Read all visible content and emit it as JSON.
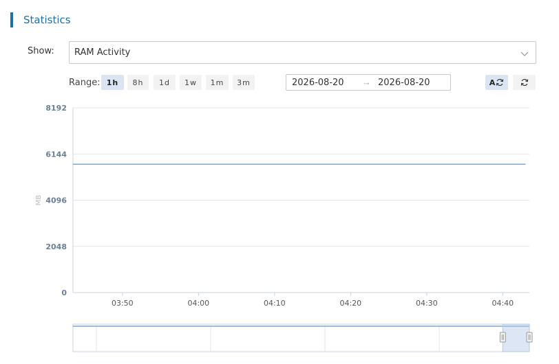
{
  "section": {
    "title": "Statistics"
  },
  "show": {
    "label": "Show:",
    "selected": "RAM Activity"
  },
  "range": {
    "label": "Range:",
    "options": [
      "1h",
      "8h",
      "1d",
      "1w",
      "1m",
      "3m"
    ],
    "active": "1h"
  },
  "date_range": {
    "start": "2026-08-20",
    "arrow": "→",
    "end": "2026-08-20"
  },
  "toolbar": {
    "auto_label": "A",
    "auto_icon": "auto-refresh-icon",
    "refresh_icon": "refresh-icon"
  },
  "colors": {
    "accent": "#1f6fa8",
    "series": "#7aa6d6",
    "active_button": "#dbe4f3"
  },
  "chart_data": {
    "type": "line",
    "title": "",
    "xlabel": "",
    "ylabel": "MB",
    "yticks": [
      0,
      2048,
      4096,
      6144,
      8192
    ],
    "ylim": [
      0,
      8192
    ],
    "xticks": [
      "03:50",
      "04:00",
      "04:10",
      "04:20",
      "04:30",
      "04:40"
    ],
    "xlim": [
      "03:43:30",
      "04:43:30"
    ],
    "grid": true,
    "series": [
      {
        "x": [
          "03:43:30",
          "04:43:00"
        ],
        "y": [
          5690,
          5690
        ]
      }
    ],
    "navigator": {
      "selection_start": "04:40",
      "selection_end": "04:43:30"
    }
  }
}
